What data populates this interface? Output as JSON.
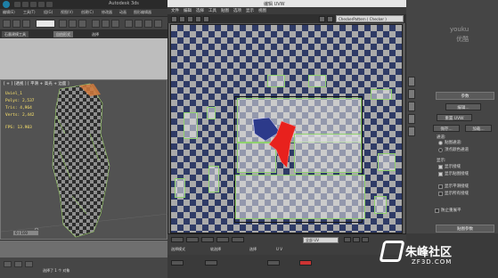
{
  "app": {
    "title": "Autodesk 3ds",
    "menu": [
      "编辑(E)",
      "工具(T)",
      "组(G)",
      "视图(V)",
      "创建(C)",
      "修改器",
      "动画",
      "图形编辑器"
    ],
    "ribbon_tabs": [
      "石墨建模工具",
      "自由形式",
      "选择"
    ]
  },
  "viewport": {
    "label": "[ + ] [透视 ] [ 平滑 + 高光 + 边面 ]",
    "stats": {
      "object": "Uviel_1",
      "polys": "Polys: 2,537",
      "tris": "Tris: 4,964",
      "verts": "Verts: 2,442",
      "fps": "FPS: 13.903"
    }
  },
  "timeline": {
    "frame": "0 / 100"
  },
  "status": {
    "selection": "选择了 1 个 对象"
  },
  "uvw_editor": {
    "title": "编辑 UVW",
    "menu": [
      "文件",
      "编辑",
      "选择",
      "工具",
      "贴图",
      "选项",
      "显示",
      "视图"
    ],
    "checker_dropdown": "CheckerPattern ( Checker )",
    "zoom": "全部 UV",
    "bottom": {
      "sub_label": "选择模式",
      "soft_label": "软选择",
      "pick_label": "选择",
      "xy_label": "U V"
    }
  },
  "command_panel": {
    "watermark_top": "youku",
    "watermark_bottom": "优酷",
    "params_header": "参数",
    "edit_button": "编辑...",
    "reset_button": "重置 UVW",
    "save_button": "保存...",
    "load_button": "加载...",
    "channel_label": "通道:",
    "map_channel_label": "贴图通道:",
    "vertex_color_label": "顶点颜色通道",
    "display_label": "显示:",
    "display_options": [
      {
        "label": "显示接缝",
        "checked": true
      },
      {
        "label": "显示贴图接缝",
        "checked": true
      },
      {
        "label": "显示平滑接缝",
        "checked": false
      },
      {
        "label": "显示所有接缝",
        "checked": false
      }
    ],
    "prevent_reflatten": "防止重展平",
    "map_params_header": "贴图参数"
  },
  "logo": {
    "main": "朱峰社区",
    "sub": "ZF3D.COM"
  }
}
